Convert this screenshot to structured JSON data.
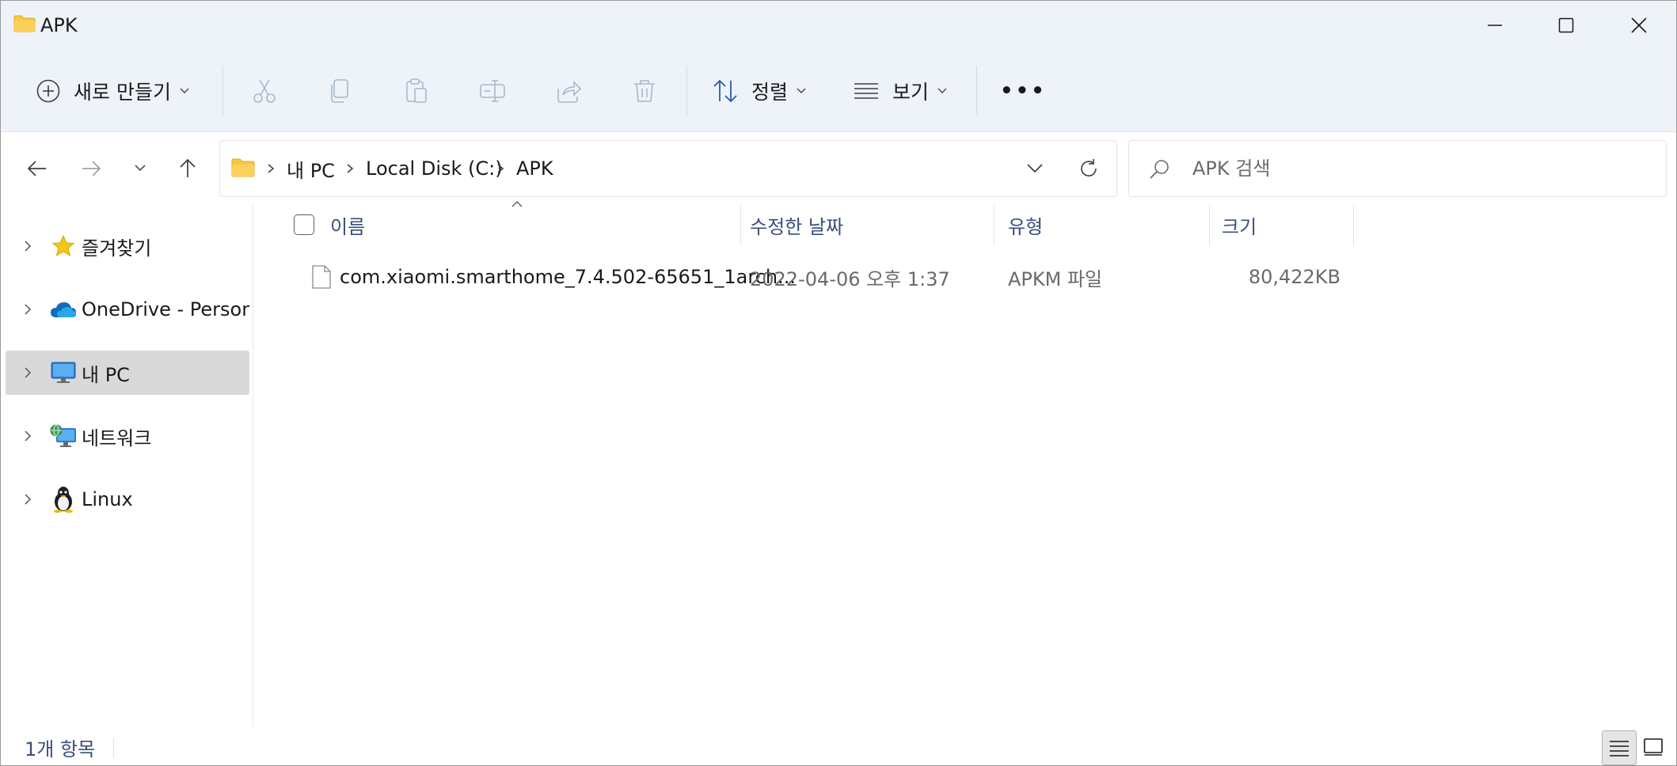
{
  "window": {
    "title": "APK",
    "controls": {
      "minimize": "minimize",
      "maximize": "maximize",
      "close": "close"
    }
  },
  "toolbar": {
    "new_label": "새로 만들기",
    "sort_label": "정렬",
    "view_label": "보기",
    "more_label": "•••",
    "icons": [
      "add-circle-icon",
      "cut-icon",
      "copy-icon",
      "paste-icon",
      "rename-icon",
      "share-icon",
      "delete-icon",
      "sort-icon",
      "view-icon",
      "more-icon"
    ]
  },
  "navigation": {
    "breadcrumb": [
      "내 PC",
      "Local Disk (C:)",
      "APK"
    ],
    "search_placeholder": "APK 검색"
  },
  "sidebar": {
    "items": [
      {
        "label": "즐겨찾기",
        "icon": "star-icon",
        "selected": false
      },
      {
        "label": "OneDrive - Persona",
        "icon": "cloud-icon",
        "selected": false
      },
      {
        "label": "내 PC",
        "icon": "monitor-icon",
        "selected": true
      },
      {
        "label": "네트워크",
        "icon": "network-icon",
        "selected": false
      },
      {
        "label": "Linux",
        "icon": "penguin-icon",
        "selected": false
      }
    ]
  },
  "file_list": {
    "columns": [
      "이름",
      "수정한 날짜",
      "유형",
      "크기"
    ],
    "rows": [
      {
        "name": "com.xiaomi.smarthome_7.4.502-65651_1arch...",
        "modified": "2022-04-06 오후 1:37",
        "type": "APKM 파일",
        "size": "80,422KB",
        "icon": "file-icon"
      }
    ]
  },
  "status": {
    "item_count": "1개 항목",
    "view_modes": [
      "details-view-icon",
      "tiles-view-icon"
    ]
  },
  "colors": {
    "chrome_bg": "#eef3fa",
    "selected_bg": "#d9d9d9",
    "header_text": "#3a4f79",
    "folder_yellow": "#f8c843",
    "accent_blue": "#0f6cbd"
  }
}
